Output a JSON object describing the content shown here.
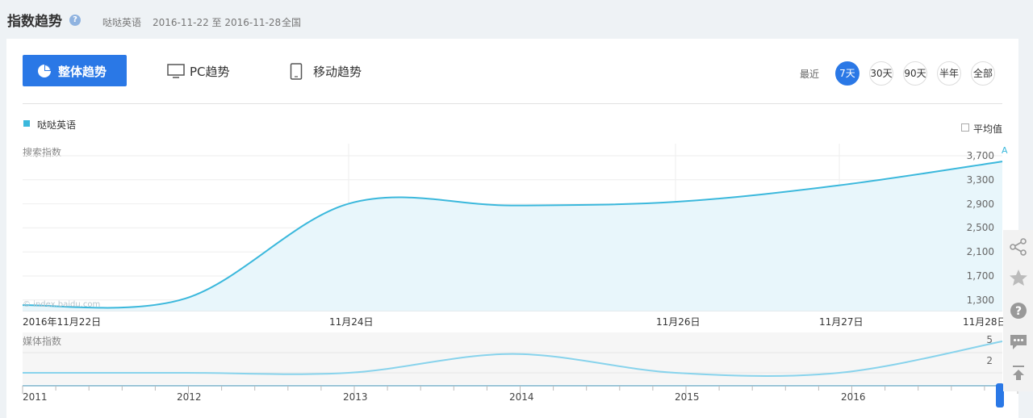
{
  "header": {
    "title": "指数趋势",
    "keyword": "哒哒英语",
    "date_range": "2016-11-22 至 2016-11-28",
    "region": "全国"
  },
  "tabs": [
    {
      "label": "整体趋势",
      "active": true,
      "icon": "pie-chart-icon"
    },
    {
      "label": "PC趋势",
      "active": false,
      "icon": "monitor-icon"
    },
    {
      "label": "移动趋势",
      "active": false,
      "icon": "tablet-icon"
    }
  ],
  "range": {
    "label": "最近",
    "options": [
      "7天",
      "30天",
      "90天",
      "半年",
      "全部"
    ],
    "selected": "7天"
  },
  "legend": {
    "series": "哒哒英语",
    "color": "#3bb8dc"
  },
  "average_toggle": {
    "label": "平均值",
    "checked": false
  },
  "search_chart": {
    "label": "搜索指数",
    "watermark": "© index.baidu.com",
    "marker": "A",
    "y_ticks": [
      "3,700",
      "3,300",
      "2,900",
      "2,500",
      "2,100",
      "1,700",
      "1,300"
    ],
    "x_ticks": [
      "2016年11月22日",
      "11月24日",
      "11月26日",
      "11月27日",
      "11月28日"
    ]
  },
  "media_chart": {
    "label": "媒体指数",
    "y_ticks": [
      "5",
      "2"
    ]
  },
  "brush": {
    "years": [
      "2011",
      "2012",
      "2013",
      "2014",
      "2015",
      "2016"
    ]
  },
  "chart_data": {
    "type": "area",
    "series": [
      {
        "name": "哒哒英语",
        "color": "#3bb8dc"
      }
    ],
    "x": [
      "2016-11-22",
      "2016-11-23",
      "2016-11-24",
      "2016-11-25",
      "2016-11-26",
      "2016-11-27",
      "2016-11-28"
    ],
    "values": [
      1290,
      1400,
      2950,
      2920,
      2980,
      3250,
      3640
    ],
    "ylim": [
      1200,
      3800
    ],
    "media_values": [
      0,
      0,
      0,
      3,
      0,
      0,
      5
    ],
    "grid": true
  },
  "sidebar_tools": [
    "share-icon",
    "star-icon",
    "help-circle-icon",
    "comment-icon",
    "back-to-top-icon"
  ]
}
